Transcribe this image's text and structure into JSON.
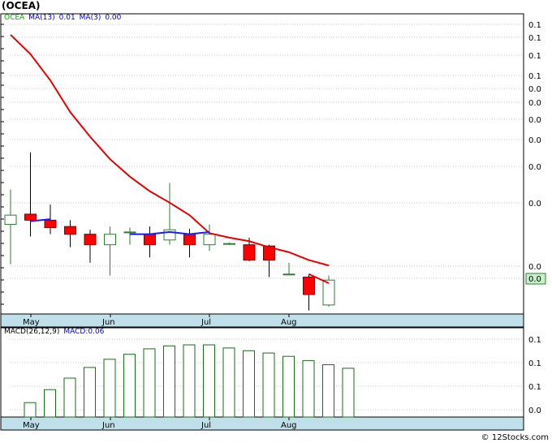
{
  "title": "(OCEA)",
  "credit": "© 12Stocks.com",
  "colors": {
    "up_candle_fill": "#ffffff",
    "up_candle_stroke": "#2e7d32",
    "down_candle_fill": "#ff0000",
    "down_candle_stroke": "#b00000",
    "ma13": "#e60000",
    "ma3": "#1a1aff",
    "macd_bar": "#1b6b1b",
    "axis_strip": "#bfe0ea",
    "grid": "#c8c8c8",
    "last_price_box": "#c8f0c8"
  },
  "chart_data": [
    {
      "type": "candlestick",
      "legend": [
        {
          "text": "OCEA",
          "color": "#00aa00"
        },
        {
          "text": "MA(13)",
          "color": "#0000cc"
        },
        {
          "text": "0.01",
          "color": "#0000cc"
        },
        {
          "text": "MA(3)",
          "color": "#0000cc"
        },
        {
          "text": "0.00",
          "color": "#0000cc"
        }
      ],
      "x_labels": [
        "May",
        "Jun",
        "Jul",
        "Aug"
      ],
      "y_tick_labels": [
        "0.1",
        "0.1",
        "0.1",
        "0.1",
        "0.0",
        "0.0",
        "0.0",
        "0.0",
        "0.0",
        "0.0",
        "0.0",
        "0.0"
      ],
      "last_price_label": "0.0",
      "candles": [
        {
          "o": 0.0143,
          "h": 0.018,
          "l": 0.011,
          "c": 0.0152,
          "up": true
        },
        {
          "o": 0.0153,
          "h": 0.023,
          "l": 0.0132,
          "c": 0.0147,
          "up": false
        },
        {
          "o": 0.0147,
          "h": 0.0163,
          "l": 0.0134,
          "c": 0.014,
          "up": false
        },
        {
          "o": 0.0141,
          "h": 0.0147,
          "l": 0.0123,
          "c": 0.0134,
          "up": false
        },
        {
          "o": 0.0134,
          "h": 0.0138,
          "l": 0.0111,
          "c": 0.0125,
          "up": false
        },
        {
          "o": 0.0125,
          "h": 0.0141,
          "l": 0.0102,
          "c": 0.0134,
          "up": true
        },
        {
          "o": 0.0136,
          "h": 0.014,
          "l": 0.0125,
          "c": 0.0136,
          "up": true
        },
        {
          "o": 0.0134,
          "h": 0.0141,
          "l": 0.0115,
          "c": 0.0125,
          "up": false
        },
        {
          "o": 0.0129,
          "h": 0.0188,
          "l": 0.0125,
          "c": 0.0138,
          "up": true
        },
        {
          "o": 0.0134,
          "h": 0.0139,
          "l": 0.0115,
          "c": 0.0125,
          "up": false
        },
        {
          "o": 0.0125,
          "h": 0.0143,
          "l": 0.012,
          "c": 0.0134,
          "up": true
        },
        {
          "o": 0.0126,
          "h": 0.0127,
          "l": 0.0125,
          "c": 0.0126,
          "up": true
        },
        {
          "o": 0.0125,
          "h": 0.0131,
          "l": 0.0112,
          "c": 0.0113,
          "up": false
        },
        {
          "o": 0.0124,
          "h": 0.0125,
          "l": 0.0101,
          "c": 0.0113,
          "up": false
        },
        {
          "o": 0.0103,
          "h": 0.0111,
          "l": 0.0103,
          "c": 0.0103,
          "up": true
        },
        {
          "o": 0.0101,
          "h": 0.0103,
          "l": 0.0081,
          "c": 0.009,
          "up": false
        },
        {
          "o": 0.0084,
          "h": 0.0102,
          "l": 0.0083,
          "c": 0.0099,
          "up": true
        }
      ],
      "ma13": [
        0.05,
        0.044,
        0.037,
        0.03,
        0.0255,
        0.022,
        0.0196,
        0.0178,
        0.0165,
        0.0152,
        0.0135,
        0.0131,
        0.0128,
        0.0123,
        0.0119,
        0.0113,
        0.0109
      ],
      "ma3": [
        null,
        0.0146,
        0.0148,
        null,
        null,
        null,
        0.0134,
        0.0134,
        0.0136,
        0.0134,
        0.0136,
        null,
        null,
        null,
        null,
        null,
        null
      ],
      "ma13_last_segment": [
        0.0103,
        0.0097
      ]
    },
    {
      "type": "bar",
      "legend": [
        {
          "text": "MACD(26,12,9)",
          "color": "#000000"
        },
        {
          "text": "MACD:0.06",
          "color": "#0000cc"
        }
      ],
      "x_labels": [
        "May",
        "Jun",
        "Jul",
        "Aug"
      ],
      "y_tick_labels": [
        "0.1",
        "0.1",
        "0.1",
        "0.1",
        "0.0"
      ],
      "values": [
        0.0069,
        0.0131,
        0.0186,
        0.0237,
        0.0276,
        0.03,
        0.0326,
        0.034,
        0.0345,
        0.0345,
        0.033,
        0.0317,
        0.0306,
        0.029,
        0.027,
        0.025,
        0.0233
      ],
      "ylim": [
        0,
        0.038
      ]
    }
  ]
}
